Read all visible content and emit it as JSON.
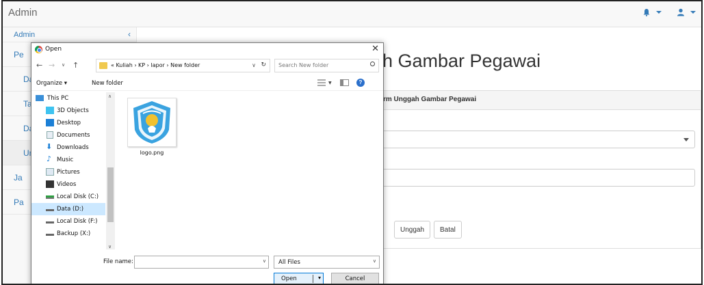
{
  "navbar": {
    "brand": "Admin"
  },
  "sidebar": {
    "header": "Admin",
    "items": [
      {
        "label": "Pe",
        "active": false
      },
      {
        "label": "Da",
        "active": false
      },
      {
        "label": "Ta",
        "active": false
      },
      {
        "label": "Da",
        "active": false
      },
      {
        "label": "Un",
        "active": true
      },
      {
        "label": "Ja",
        "active": false
      },
      {
        "label": "Pa",
        "active": false
      }
    ]
  },
  "main": {
    "title": "h Gambar Pegawai",
    "panel_heading": "rm Unggah Gambar Pegawai",
    "buttons": {
      "upload": "Unggah",
      "cancel": "Batal"
    }
  },
  "dialog": {
    "title": "Open",
    "address_path": "« Kuliah  ›  KP  ›  lapor  ›  New folder",
    "search_placeholder": "Search New folder",
    "toolbar": {
      "organize": "Organize ▾",
      "new_folder": "New folder"
    },
    "nav_items": [
      {
        "label": "This PC",
        "icon": "this-pc-icon"
      },
      {
        "label": "3D Objects",
        "icon": "3d-objects-icon"
      },
      {
        "label": "Desktop",
        "icon": "desktop-icon"
      },
      {
        "label": "Documents",
        "icon": "documents-icon"
      },
      {
        "label": "Downloads",
        "icon": "downloads-icon"
      },
      {
        "label": "Music",
        "icon": "music-icon"
      },
      {
        "label": "Pictures",
        "icon": "pictures-icon"
      },
      {
        "label": "Videos",
        "icon": "videos-icon"
      },
      {
        "label": "Local Disk (C:)",
        "icon": "local-disk-icon"
      },
      {
        "label": "Data (D:)",
        "icon": "drive-icon",
        "selected": true
      },
      {
        "label": "Local Disk (F:)",
        "icon": "drive-icon"
      },
      {
        "label": "Backup (X:)",
        "icon": "drive-icon"
      }
    ],
    "file": {
      "name": "logo.png"
    },
    "file_name_label": "File name:",
    "file_name_value": "",
    "file_type": "All Files",
    "open_label": "Open",
    "cancel_label": "Cancel"
  }
}
